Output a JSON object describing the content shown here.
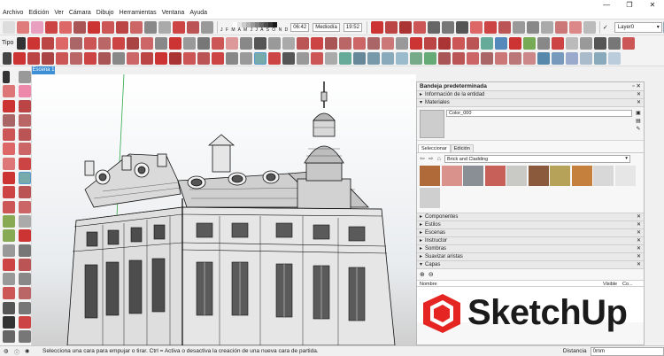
{
  "app": {
    "menu": [
      "Archivo",
      "Edición",
      "Ver",
      "Cámara",
      "Dibujo",
      "Herramientas",
      "Ventana",
      "Ayuda"
    ],
    "window_controls": [
      "—",
      "❐",
      "✕"
    ]
  },
  "toolbar": {
    "tag_label": "Tipo",
    "shadow_letters": "J F M A M J J A S O N D",
    "time_start": "06:42",
    "time_mid": "Mediodía",
    "time_end": "19:52",
    "layer_value": "Layer0",
    "layer_check": "✓"
  },
  "scene_tab": "Escena 1",
  "tray": {
    "title": "Bandeja predeterminada",
    "pin": "▫ ✕",
    "entity_info": "Información de la entidad",
    "materials": "Materiales",
    "material_name": "Color_000",
    "tab_select": "Seleccionar",
    "tab_edit": "Edición",
    "library": "Brick and Cladding",
    "swatch_colors": [
      "#b06a3a",
      "#d9928c",
      "#8a8f96",
      "#c8605a",
      "#c9c9c6",
      "#8b5a3c",
      "#b7a25a",
      "#c4803c",
      "#d8d8d8",
      "#e6e6e6",
      "#cfcfcf"
    ],
    "sections": [
      "Componentes",
      "Estilos",
      "Escenas",
      "Instructor",
      "Sombras",
      "Suavizar aristas"
    ],
    "capas": "Capas",
    "col_name": "Nombre",
    "col_visible": "Visible",
    "col_color": "Co...",
    "arrow_closed": "▸",
    "arrow_open": "▾",
    "close": "✕"
  },
  "logo": {
    "text": "SketchUp"
  },
  "status": {
    "message": "Selecciona una cara para empujar o tirar. Ctrl = Activa o desactiva la creación de una nueva cara de partida.",
    "measure_label": "Distancia",
    "measure_value": "0mm"
  }
}
